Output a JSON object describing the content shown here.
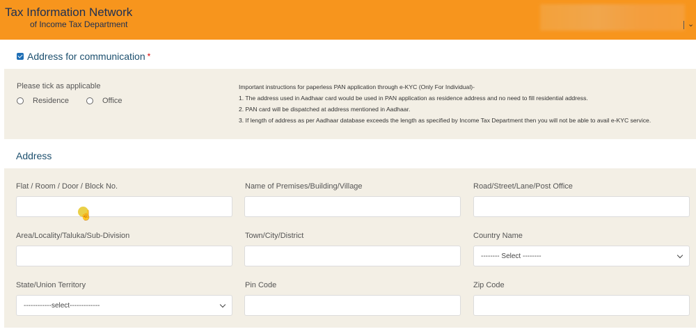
{
  "header": {
    "brand_line1": "Tax Information Network",
    "brand_line2": "of Income Tax Department",
    "accent_color": "#f7951d"
  },
  "communication": {
    "checked": true,
    "label": "Address for communication",
    "required_mark": "*"
  },
  "applicability": {
    "prompt": "Please tick as applicable",
    "options": [
      "Residence",
      "Office"
    ]
  },
  "instructions": {
    "title": "Important instructions for paperless PAN application through e-KYC (Only For Individual)-",
    "items": [
      "1. The address used in Aadhaar card would be used in PAN application as residence address and no need to fill residential address.",
      "2. PAN card will be dispatched at address mentioned in Aadhaar.",
      "3. If length of address as per Aadhaar database exceeds the length as specified by Income Tax Department then you will not be able to avail e-KYC service."
    ]
  },
  "address": {
    "section_title": "Address",
    "fields": {
      "flat": {
        "label": "Flat / Room / Door / Block No.",
        "value": ""
      },
      "premises": {
        "label": "Name of Premises/Building/Village",
        "value": ""
      },
      "road": {
        "label": "Road/Street/Lane/Post Office",
        "value": ""
      },
      "area": {
        "label": "Area/Locality/Taluka/Sub-Division",
        "value": ""
      },
      "town": {
        "label": "Town/City/District",
        "value": ""
      },
      "country": {
        "label": "Country Name",
        "selected": "-------- Select --------"
      },
      "state": {
        "label": "State/Union Territory",
        "selected": "------------select-------------"
      },
      "pincode": {
        "label": "Pin Code",
        "value": ""
      },
      "zipcode": {
        "label": "Zip Code",
        "value": ""
      }
    }
  }
}
